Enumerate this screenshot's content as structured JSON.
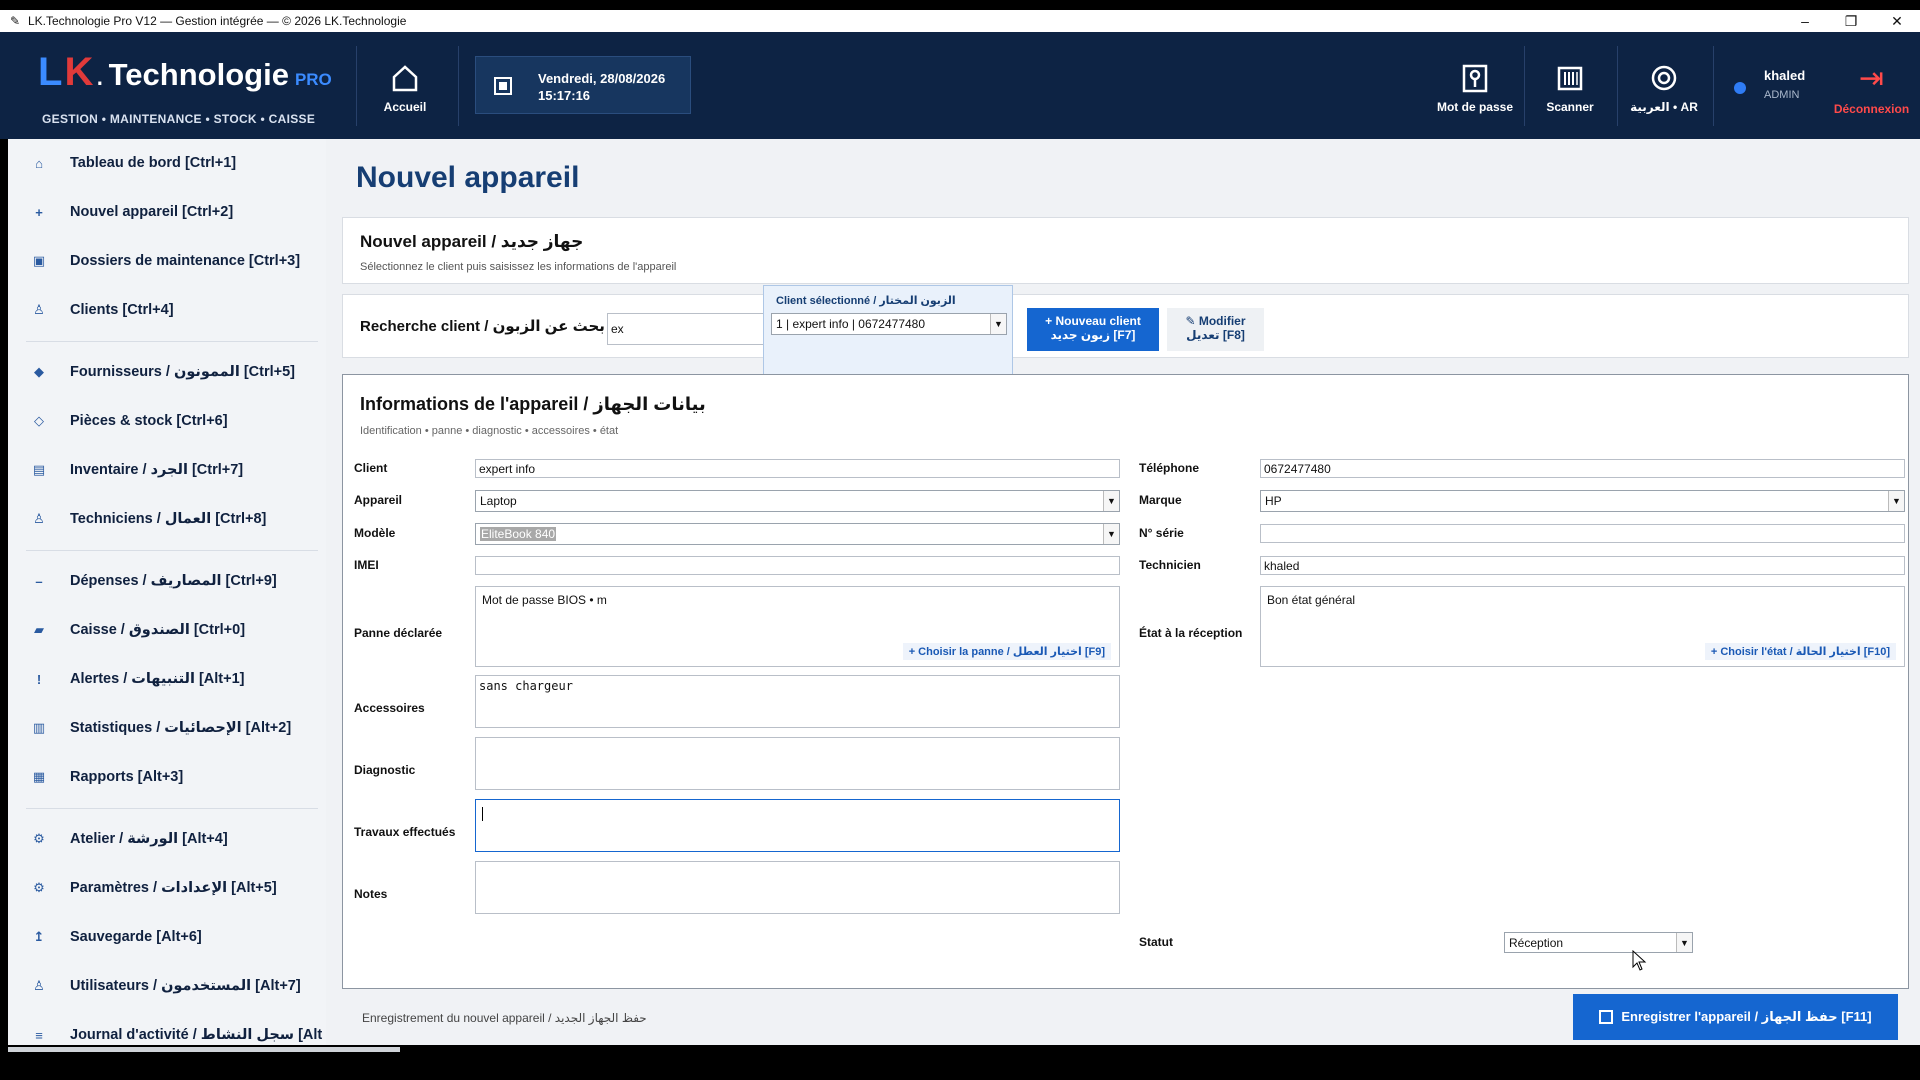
{
  "window": {
    "title": "LK.Technologie Pro V12 — Gestion intégrée — © 2026 LK.Technologie",
    "minimize": "–",
    "restore": "❐",
    "close": "✕"
  },
  "header": {
    "logo": {
      "l": "L",
      "k": "K",
      "dot": ".",
      "name": "Technologie",
      "pro": "PRO"
    },
    "tagline": "GESTION • MAINTENANCE • STOCK • CAISSE",
    "home_label": "Accueil",
    "date": "Vendredi, 28/08/2026",
    "time": "15:17:16",
    "password_label": "Mot de passe",
    "scanner_label": "Scanner",
    "language_label": "العربية • AR",
    "user_name": "khaled",
    "user_role": "ADMIN",
    "logout_label": "Déconnexion",
    "colors": {
      "bg": "#0d2344",
      "accent": "#3b8bff",
      "danger": "#ff4a4a"
    }
  },
  "sidebar": {
    "items": [
      {
        "icon": "⌂",
        "icon_name": "home-icon",
        "label": "Tableau de bord   [Ctrl+1]"
      },
      {
        "icon": "+",
        "icon_name": "plus-icon",
        "label": "Nouvel appareil   [Ctrl+2]"
      },
      {
        "icon": "▣",
        "icon_name": "folder-icon",
        "label": "Dossiers de maintenance   [Ctrl+3]"
      },
      {
        "icon": "♙",
        "icon_name": "client-icon",
        "label": "Clients   [Ctrl+4]"
      },
      {
        "icon": "◆",
        "icon_name": "supplier-icon",
        "label": "Fournisseurs / الممونون   [Ctrl+5]"
      },
      {
        "icon": "◇",
        "icon_name": "parts-icon",
        "label": "Pièces & stock   [Ctrl+6]"
      },
      {
        "icon": "▤",
        "icon_name": "inventory-icon",
        "label": "Inventaire / الجرد   [Ctrl+7]"
      },
      {
        "icon": "♙",
        "icon_name": "technician-icon",
        "label": "Techniciens / العمال   [Ctrl+8]"
      },
      {
        "icon": "–",
        "icon_name": "expense-icon",
        "label": "Dépenses / المصاريف   [Ctrl+9]"
      },
      {
        "icon": "▰",
        "icon_name": "cash-icon",
        "label": "Caisse / الصندوق   [Ctrl+0]"
      },
      {
        "icon": "!",
        "icon_name": "alert-icon",
        "label": "Alertes / التنبيهات   [Alt+1]"
      },
      {
        "icon": "▥",
        "icon_name": "stats-icon",
        "label": "Statistiques / الإحصائيات   [Alt+2]"
      },
      {
        "icon": "▦",
        "icon_name": "reports-icon",
        "label": "Rapports   [Alt+3]"
      },
      {
        "icon": "⚙",
        "icon_name": "workshop-icon",
        "label": "Atelier / الورشة   [Alt+4]"
      },
      {
        "icon": "⚙",
        "icon_name": "settings-icon",
        "label": "Paramètres / الإعدادات   [Alt+5]"
      },
      {
        "icon": "↥",
        "icon_name": "backup-icon",
        "label": "Sauvegarde   [Alt+6]"
      },
      {
        "icon": "♙",
        "icon_name": "users-icon",
        "label": "Utilisateurs / المستخدمون   [Alt+7]"
      },
      {
        "icon": "≡",
        "icon_name": "journal-icon",
        "label": "Journal d'activité / سجل النشاط   [Alt"
      }
    ]
  },
  "main": {
    "page_title": "Nouvel appareil",
    "header_card": {
      "title": "Nouvel appareil / جهاز جديد",
      "subtitle": "Sélectionnez le client puis saisissez les informations de l'appareil"
    },
    "client_search": {
      "label": "Recherche client / بحث عن الزبون",
      "value": "ex",
      "selected_header": "Client sélectionné / الزبون المختار",
      "selected_value": "1 | expert info | 0672477480",
      "new_client_line1": "+ Nouveau client",
      "new_client_line2": "زبون جديد   [F7]",
      "modify_line1": "✎ Modifier",
      "modify_line2": "تعديل   [F8]"
    },
    "device_info": {
      "title": "Informations de l'appareil / بيانات الجهاز",
      "subtitle": "Identification • panne • diagnostic • accessoires • état",
      "labels": {
        "client": "Client",
        "phone": "Téléphone",
        "device": "Appareil",
        "brand": "Marque",
        "model": "Modèle",
        "serial": "N° série",
        "imei": "IMEI",
        "technician": "Technicien",
        "fault": "Panne déclarée",
        "reception_state": "État à la réception",
        "accessories": "Accessoires",
        "diagnostic": "Diagnostic",
        "works": "Travaux effectués",
        "notes": "Notes",
        "status": "Statut"
      },
      "values": {
        "client": "expert info",
        "phone": "0672477480",
        "device": "Laptop",
        "brand": "HP",
        "model": "EliteBook 840",
        "serial": "",
        "imei": "",
        "technician": "khaled",
        "fault": "Mot de passe BIOS • m",
        "reception_state": "Bon état général",
        "accessories": "sans chargeur",
        "diagnostic": "",
        "works": "",
        "notes": "",
        "status": "Réception"
      },
      "choose_fault": "+ Choisir la panne / اختيار العطل   [F9]",
      "choose_state": "+ Choisir l'état / اختيار الحالة   [F10]"
    },
    "footer": {
      "text": "Enregistrement du nouvel appareil / حفظ الجهاز الجديد",
      "save_label": "Enregistrer l'appareil / حفظ الجهاز   [F11]"
    }
  }
}
